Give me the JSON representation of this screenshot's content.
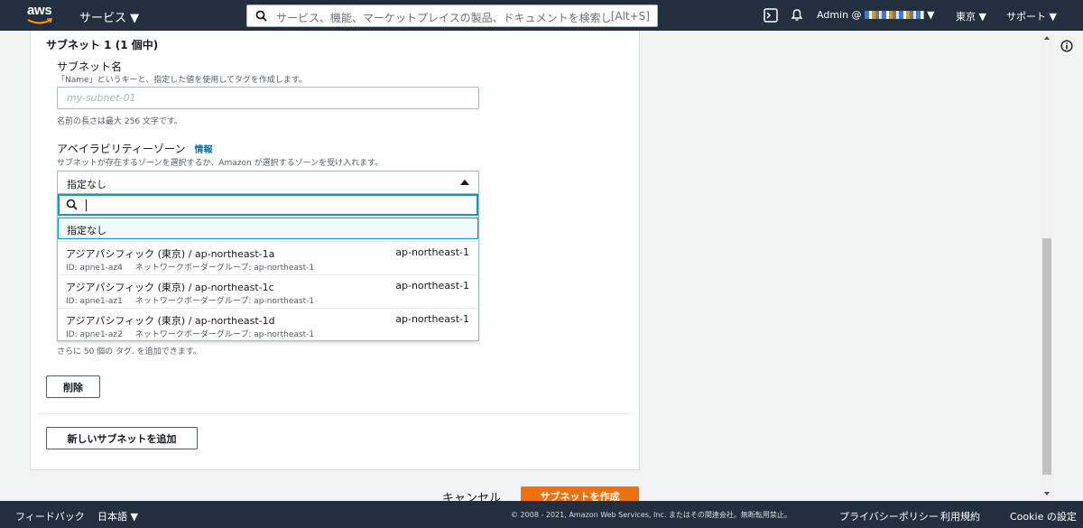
{
  "topnav": {
    "logo_text": "aws",
    "services_label": "サービス ▼",
    "search_placeholder": "サービス、機能、マーケットプレイスの製品、ドキュメントを検索し",
    "search_shortcut": "[Alt+S]",
    "account_label": "Admin @",
    "account_caret": "▼",
    "region_label": "東京 ▼",
    "support_label": "サポート ▼",
    "icons": [
      "search-icon",
      "cloudshell-icon",
      "bell-icon",
      "info-icon"
    ]
  },
  "subnet": {
    "heading": "サブネット 1 (1 個中)",
    "name_label": "サブネット名",
    "name_desc": "「Name」というキーと、指定した値を使用してタグを作成します。",
    "name_placeholder": "my-subnet-01",
    "name_value": "",
    "name_hint": "名前の長さは最大 256 文字です。",
    "az_label": "アベイラビリティーゾーン",
    "az_info": "情報",
    "az_desc": "サブネットが存在するゾーンを選択するか、Amazon が選択するゾーンを受け入れます。",
    "az_selected": "指定なし",
    "az_search_value": "",
    "az_options": [
      {
        "label": "指定なし"
      },
      {
        "label": "アジアパシフィック (東京) / ap-northeast-1a",
        "region": "ap-northeast-1",
        "id": "ID: apne1-az4",
        "group": "ネットワークボーダーグループ: ap-northeast-1"
      },
      {
        "label": "アジアパシフィック (東京) / ap-northeast-1c",
        "region": "ap-northeast-1",
        "id": "ID: apne1-az1",
        "group": "ネットワークボーダーグループ: ap-northeast-1"
      },
      {
        "label": "アジアパシフィック (東京) / ap-northeast-1d",
        "region": "ap-northeast-1",
        "id": "ID: apne1-az2",
        "group": "ネットワークボーダーグループ: ap-northeast-1"
      }
    ],
    "tags_note": "さらに 50 個の タグ. を追加できます。",
    "remove_label": "削除",
    "add_subnet_label": "新しいサブネットを追加"
  },
  "actions": {
    "cancel_label": "キャンセル",
    "create_label": "サブネットを作成"
  },
  "footer": {
    "feedback": "フィードバック",
    "language": "日本語 ▼",
    "copyright": "© 2008 - 2021, Amazon Web Services, Inc. またはその関連会社。無断転用禁止。",
    "privacy": "プライバシーポリシー",
    "terms": "利用規約",
    "cookie": "Cookie の設定"
  },
  "colors": {
    "nav_bg": "#232f3e",
    "primary_button": "#ec7211",
    "focus_border": "#00a1c9",
    "link": "#0073bb"
  }
}
